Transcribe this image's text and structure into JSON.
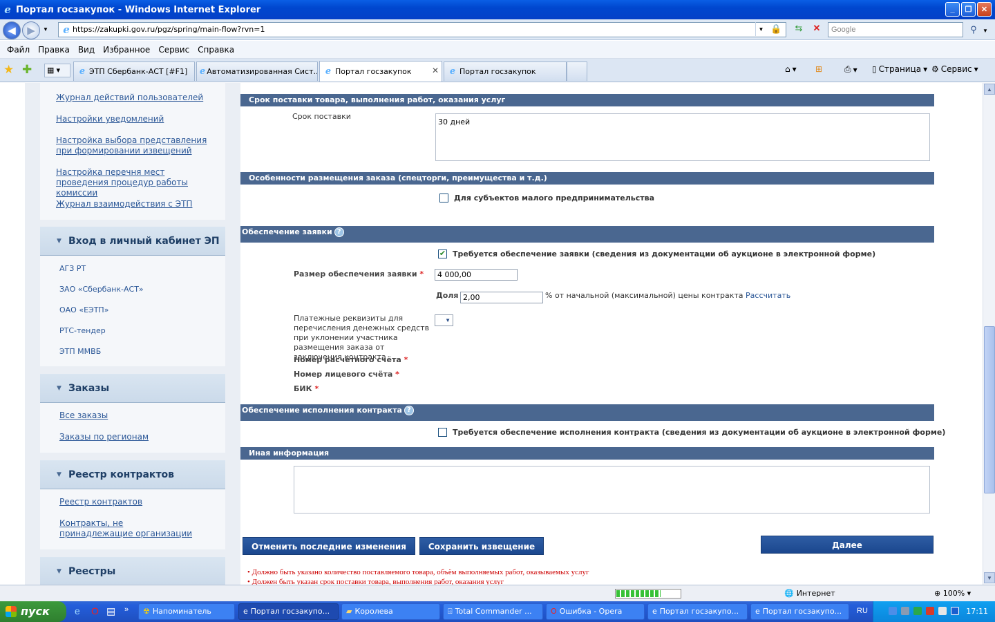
{
  "window": {
    "title": "Портал госзакупок - Windows Internet Explorer"
  },
  "address": {
    "url": "https://zakupki.gov.ru/pgz/spring/main-flow?rvn=1",
    "search_placeholder": "Google"
  },
  "menu": [
    "Файл",
    "Правка",
    "Вид",
    "Избранное",
    "Сервис",
    "Справка"
  ],
  "tabs": [
    {
      "label": "ЭТП Сбербанк-АСТ [#F1]"
    },
    {
      "label": "Автоматизированная Сист..."
    },
    {
      "label": "Портал госзакупок",
      "active": true
    },
    {
      "label": "Портал госзакупок"
    }
  ],
  "commands": {
    "page": "Страница",
    "tools": "Сервис"
  },
  "sidebar": {
    "top_links": [
      "Журнал действий пользователей",
      "Настройки уведомлений",
      "Настройка выбора представления при формировании извещений",
      "Настройка перечня мест проведения процедур работы комиссии",
      "Журнал взаимодействия с ЭТП"
    ],
    "cabinet": {
      "title": "Вход в личный кабинет ЭП",
      "items": [
        "АГЗ РТ",
        "ЗАО «Сбербанк-АСТ»",
        "ОАО «ЕЭТП»",
        "РТС-тендер",
        "ЭТП ММВБ"
      ]
    },
    "orders": {
      "title": "Заказы",
      "items": [
        "Все заказы",
        "Заказы по регионам"
      ]
    },
    "contracts": {
      "title": "Реестр контрактов",
      "items": [
        "Реестр контрактов",
        "Контракты, не принадлежащие организации"
      ]
    },
    "registries": {
      "title": "Реестры"
    }
  },
  "form": {
    "delivery": {
      "section": "Срок поставки товара, выполнения работ, оказания услуг",
      "label": "Срок поставки",
      "value": "30 дней"
    },
    "features": {
      "section": "Особенности размещения заказа (спецторги, преимущества и т.д.)",
      "small_business_label": "Для субъектов малого предпринимательства",
      "small_business_checked": false
    },
    "bid_security": {
      "section": "Обеспечение заявки",
      "required_label": "Требуется обеспечение заявки (сведения из документации об аукционе в электронной форме)",
      "required_checked": true,
      "amount_label": "Размер обеспечения заявки",
      "amount_value": "4 000,00",
      "share_label": "Доля",
      "share_value": "2,00",
      "share_suffix": "% от начальной (максимальной) цены контракта",
      "calc_link": "Рассчитать",
      "payment_label": "Платежные реквизиты для перечисления денежных средств при уклонении участника размещения заказа от заключения контракта",
      "account_label": "Номер расчётного счёта",
      "personal_account_label": "Номер лицевого счёта",
      "bik_label": "БИК"
    },
    "contract_security": {
      "section": "Обеспечение исполнения контракта",
      "required_label": "Требуется обеспечение исполнения контракта (сведения из документации об аукционе в электронной форме)",
      "required_checked": false
    },
    "other": {
      "section": "Иная информация",
      "value": ""
    },
    "required_mark": "*",
    "help_glyph": "?",
    "buttons": {
      "cancel": "Отменить последние изменения",
      "save": "Сохранить извещение",
      "next": "Далее"
    },
    "errors": [
      "Должно быть указано количество поставляемого товара, объём выполняемых работ, оказываемых услуг",
      "Должен быть указан срок поставки товара, выполнения работ, оказания услуг"
    ]
  },
  "status": {
    "zone": "Интернет",
    "zoom": "100%",
    "progress": 0.7
  },
  "taskbar": {
    "start": "пуск",
    "tasks": [
      "Напоминатель",
      "Портал госзакупо...",
      "Королева",
      "Total Commander ...",
      "Ошибка - Opera",
      "Портал госзакупо...",
      "Портал госзакупо..."
    ],
    "active_task": 1,
    "lang": "RU",
    "clock": "17:11"
  }
}
